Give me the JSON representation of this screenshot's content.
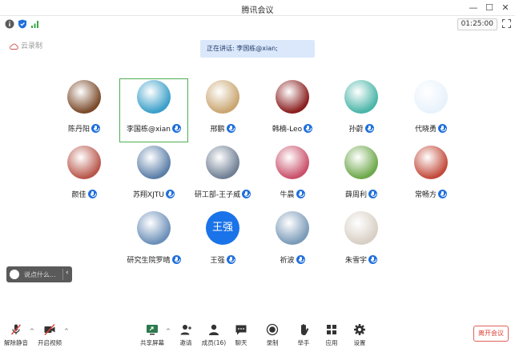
{
  "window": {
    "title": "腾讯会议"
  },
  "infobar": {
    "timer": "01:25:00"
  },
  "recording": {
    "label": "云录制"
  },
  "speaking": {
    "text": "正在讲话: 李国栋@xian;"
  },
  "participants": [
    {
      "name": "陈丹阳",
      "active": false,
      "avatar_color": "#7a4a2a"
    },
    {
      "name": "李国栋@xian",
      "active": true,
      "avatar_color": "#3a9fc9"
    },
    {
      "name": "邢鹏",
      "active": false,
      "avatar_color": "#c9a570"
    },
    {
      "name": "韩楠-Leo",
      "active": false,
      "avatar_color": "#8a1e1e"
    },
    {
      "name": "孙蔚",
      "active": false,
      "avatar_color": "#4ab5a8"
    },
    {
      "name": "代晓勇",
      "active": false,
      "avatar_color": "#e8f2fb"
    },
    {
      "name": "颜佳",
      "active": false,
      "avatar_color": "#b8564a"
    },
    {
      "name": "苏翔XJTU",
      "active": false,
      "avatar_color": "#5b7ea8"
    },
    {
      "name": "研工部-王子威",
      "active": false,
      "avatar_color": "#6f7f94"
    },
    {
      "name": "牛晨",
      "active": false,
      "avatar_color": "#c9506a"
    },
    {
      "name": "薛周利",
      "active": false,
      "avatar_color": "#6da84a"
    },
    {
      "name": "常畅方",
      "active": false,
      "avatar_color": "#c24a3a"
    },
    {
      "name": "研究生院罗晴",
      "active": false,
      "avatar_color": "#6b8fb8"
    },
    {
      "name": "王强",
      "active": false,
      "avatar_color": "#1a73e8",
      "text_avatar": "王强"
    },
    {
      "name": "祈波",
      "active": false,
      "avatar_color": "#7a9ab8"
    },
    {
      "name": "朱雪宇",
      "active": false,
      "avatar_color": "#d8cfc4"
    }
  ],
  "chat": {
    "placeholder": "说点什么..."
  },
  "toolbar": {
    "unmute": "解除静音",
    "start_video": "开启视频",
    "share_screen": "共享屏幕",
    "invite": "邀请",
    "members": "成员(16)",
    "chat": "聊天",
    "record": "录制",
    "raise_hand": "举手",
    "apps": "应用",
    "settings": "设置",
    "leave": "离开会议"
  },
  "colors": {
    "accent": "#1f6fdc",
    "active_border": "#4caf50",
    "leave_red": "#e0403a",
    "banner": "#dbe8fb"
  }
}
